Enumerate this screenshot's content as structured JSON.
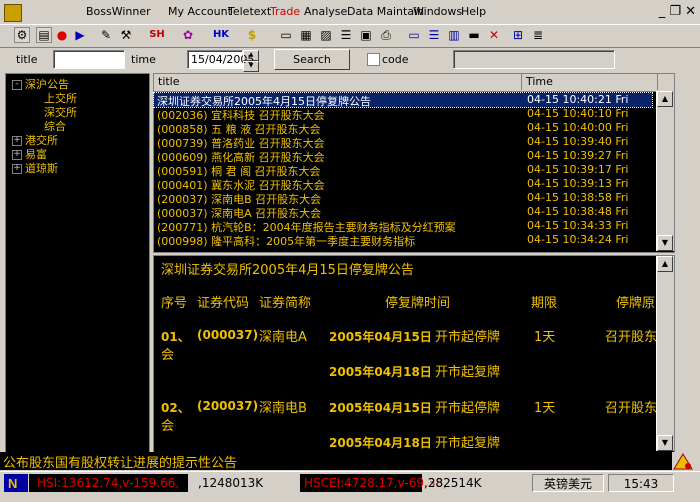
{
  "app_title": "BossWinner",
  "menu": [
    "My Account",
    "Teletext",
    "Trade",
    "Analyse",
    "Data Maintain",
    "Windows",
    "Help"
  ],
  "window_controls": "_ ❐ ✕",
  "toolbar": {
    "sh_label": "SH",
    "hk_label": "HK",
    "dollar_label": "$"
  },
  "search": {
    "title_label": "title",
    "title_value": "",
    "time_label": "time",
    "time_value": "15/04/2005",
    "button_label": "Search",
    "code_label": "code"
  },
  "tree": [
    {
      "label": "深沪公告",
      "level": 0,
      "expander": "-"
    },
    {
      "label": "上交所",
      "level": 1
    },
    {
      "label": "深交所",
      "level": 1
    },
    {
      "label": "综合",
      "level": 1
    },
    {
      "label": "港交所",
      "level": 0,
      "expander": "+"
    },
    {
      "label": "易富",
      "level": 0,
      "expander": "+"
    },
    {
      "label": "道琼斯",
      "level": 0,
      "expander": "+"
    }
  ],
  "list": {
    "headers": [
      "title",
      "Time"
    ],
    "rows": [
      {
        "title": "深圳证券交易所2005年4月15日停复牌公告",
        "time": "04-15 10:40:21 Fri",
        "selected": true
      },
      {
        "title": "(002036) 宜科科技   召开股东大会",
        "time": "04-15 10:40:10 Fri"
      },
      {
        "title": "(000858) 五 粮 液   召开股东大会",
        "time": "04-15 10:40:00 Fri"
      },
      {
        "title": "(000739) 普洛药业   召开股东大会",
        "time": "04-15 10:39:40 Fri"
      },
      {
        "title": "(000609) 燕化高新   召开股东大会",
        "time": "04-15 10:39:27 Fri"
      },
      {
        "title": "(000591) 桐 君 阁   召开股东大会",
        "time": "04-15 10:39:17 Fri"
      },
      {
        "title": "(000401) 冀东水泥   召开股东大会",
        "time": "04-15 10:39:13 Fri"
      },
      {
        "title": "(200037) 深南电B   召开股东大会",
        "time": "04-15 10:38:58 Fri"
      },
      {
        "title": "(000037) 深南电A   召开股东大会",
        "time": "04-15 10:38:48 Fri"
      },
      {
        "title": "(200771) 杭汽轮B：2004年度报告主要财务指标及分红预案",
        "time": "04-15 10:34:33 Fri"
      },
      {
        "title": "(000998) 隆平高科：2005年第一季度主要财务指标",
        "time": "04-15 10:34:24 Fri"
      }
    ]
  },
  "detail": {
    "heading": "深圳证券交易所2005年4月15日停复牌公告",
    "columns": [
      "序号",
      "证券代码",
      "证券简称",
      "停复牌时间",
      "期限",
      "停牌原因"
    ],
    "entries": [
      {
        "no": "01、",
        "code": "(000037)",
        "name": "深南电A",
        "time1": "2005年04月15日",
        "time1_action": "开市起停牌",
        "period": "1天",
        "reason": "召开股东大",
        "reason_wrap": "会",
        "time2": "2005年04月18日",
        "time2_action": "开市起复牌"
      },
      {
        "no": "02、",
        "code": "(200037)",
        "name": "深南电B",
        "time1": "2005年04月15日",
        "time1_action": "开市起停牌",
        "period": "1天",
        "reason": "召开股东大",
        "reason_wrap": "会",
        "time2": "2005年04月18日",
        "time2_action": "开市起复牌"
      }
    ]
  },
  "ticker": "公布股东国有股权转让进展的提示性公告",
  "status": {
    "hsi": "HSI:13612.74,v-159.66,",
    "hsi_vol": ",1248013K",
    "hscei": "HSCEI:4728.17,v-69.38,",
    "hscei_vol": ",282514K",
    "currency": "英镑美元",
    "clock": "15:43"
  },
  "colors": {
    "text_yellow": "#f0c000",
    "status_red": "#e00000",
    "selection": "#0a246a"
  }
}
